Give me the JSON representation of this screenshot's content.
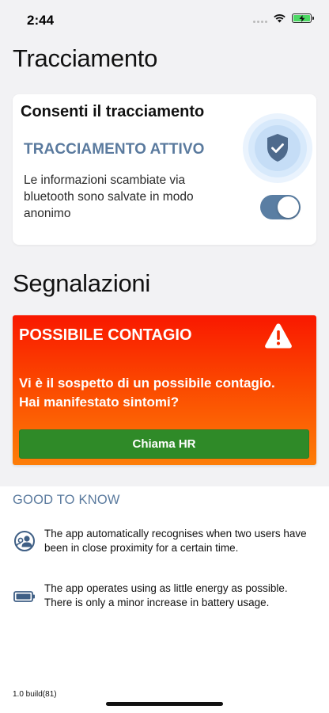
{
  "status_bar": {
    "time": "2:44",
    "icons": [
      "signal-icon",
      "wifi-icon",
      "battery-charging-icon"
    ],
    "battery_color": "#4cd964"
  },
  "tracking": {
    "title": "Tracciamento",
    "card_title": "Consenti il tracciamento",
    "status_label": "TRACCIAMENTO ATTIVO",
    "description": "Le informazioni scambiate via bluetooth sono salvate in modo anonimo",
    "toggle_on": true,
    "icon": "shield-check-icon",
    "accent_color": "#5a7a9e"
  },
  "reports": {
    "title": "Segnalazioni",
    "alert_title": "POSSIBILE CONTAGIO",
    "alert_icon": "warning-icon",
    "alert_message": "Vi è il sospetto di un possibile contagio. Hai manifestato sintomi?",
    "call_button_label": "Chiama HR",
    "gradient_colors": [
      "#f91800",
      "#fd7e08"
    ],
    "button_color": "#2f8a28"
  },
  "good_to_know": {
    "title": "GOOD TO KNOW",
    "items": [
      {
        "icon": "users-proximity-icon",
        "text": "The app automatically recognises when two users have been in close proximity for a certain time."
      },
      {
        "icon": "battery-icon",
        "text": "The app operates using as little energy as possible. There is only a minor increase in battery usage."
      }
    ]
  },
  "build_label": "1.0 build(81)"
}
